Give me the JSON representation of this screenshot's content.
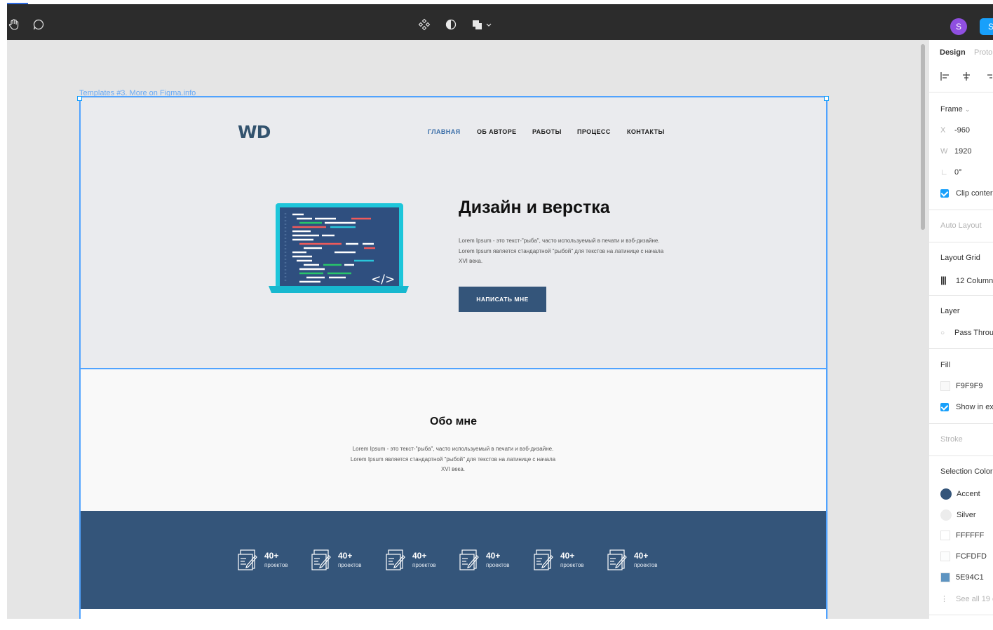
{
  "toolbar": {
    "icons": [
      "hand-tool-icon",
      "comment-icon",
      "component-icon",
      "contrast-icon",
      "boolean-ops-icon"
    ],
    "avatar_initial": "S",
    "share_label": "S"
  },
  "canvas": {
    "frame_label": "Templates #3. More on Figma.info",
    "site": {
      "logo": "WD",
      "nav": [
        "ГЛАВНАЯ",
        "ОБ АВТОРЕ",
        "РАБОТЫ",
        "ПРОЦЕСС",
        "КОНТАКТЫ"
      ],
      "hero": {
        "title": "Дизайн и верстка",
        "text": "Lorem Ipsum - это текст-\"рыба\", часто используемый в печати и вэб-дизайне. Lorem Ipsum является стандартной \"рыбой\" для текстов на латинице с начала XVI века.",
        "button": "НАПИСАТЬ МНЕ",
        "code_tag": "</>"
      },
      "about": {
        "title": "Обо мне",
        "text": "Lorem Ipsum - это текст-\"рыба\", часто используемый в печати и вэб-дизайне. Lorem Ipsum является стандартной \"рыбой\" для текстов на латинице с начала XVI века."
      },
      "stats": [
        {
          "number": "40+",
          "label": "проектов"
        },
        {
          "number": "40+",
          "label": "проектов"
        },
        {
          "number": "40+",
          "label": "проектов"
        },
        {
          "number": "40+",
          "label": "проектов"
        },
        {
          "number": "40+",
          "label": "проектов"
        },
        {
          "number": "40+",
          "label": "проектов"
        }
      ]
    }
  },
  "panel": {
    "tabs": {
      "design": "Design",
      "prototype": "Proto"
    },
    "frame_header": "Frame",
    "x_label": "X",
    "x_value": "-960",
    "w_label": "W",
    "w_value": "1920",
    "rotation": "0°",
    "clip_content": "Clip conter",
    "auto_layout": "Auto Layout",
    "layout_grid": "Layout Grid",
    "grid_value": "12 Columns",
    "layer": "Layer",
    "layer_mode": "Pass Throu",
    "fill": "Fill",
    "fill_value": "F9F9F9",
    "show_export": "Show in ex",
    "stroke": "Stroke",
    "selection_colors": "Selection Color",
    "colors": [
      {
        "name": "Accent",
        "hex": "#34557a",
        "shape": "dot"
      },
      {
        "name": "Silver",
        "hex": "#ececec",
        "shape": "dot"
      },
      {
        "name": "FFFFFF",
        "hex": "#ffffff",
        "shape": "square"
      },
      {
        "name": "FCFDFD",
        "hex": "#fcfdfd",
        "shape": "square"
      },
      {
        "name": "5E94C1",
        "hex": "#5e94c1",
        "shape": "square"
      }
    ],
    "see_all": "See all 19 c"
  }
}
